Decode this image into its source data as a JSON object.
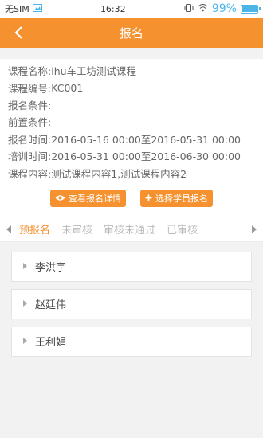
{
  "status_bar": {
    "carrier": "无SIM",
    "time": "16:32",
    "battery_percent": "99%",
    "battery_level": 0.99,
    "icons": [
      "gallery-icon",
      "vibrate-icon",
      "wifi-icon",
      "battery-icon"
    ]
  },
  "header": {
    "title": "报名",
    "back_icon": "back-arrow-icon",
    "color": "#f5912f"
  },
  "course": {
    "fields": [
      {
        "label": "课程名称:",
        "value": "lhu车工坊测试课程"
      },
      {
        "label": "课程编号:",
        "value": "KC001"
      },
      {
        "label": "报名条件:",
        "value": ""
      },
      {
        "label": "前置条件:",
        "value": ""
      },
      {
        "label": "报名时间:",
        "value": "2016-05-16 00:00至2016-05-31 00:00"
      },
      {
        "label": "培训时间:",
        "value": "2016-05-31 00:00至2016-06-30 00:00"
      },
      {
        "label": "课程内容:",
        "value": "测试课程内容1,测试课程内容2"
      }
    ]
  },
  "actions": {
    "view_details": "查看报名详情",
    "select_students": "选择学员报名"
  },
  "tabs": {
    "items": [
      "预报名",
      "未审核",
      "审核未通过",
      "已审核"
    ],
    "active_index": 0
  },
  "students": [
    {
      "name": "李洪宇"
    },
    {
      "name": "赵廷伟"
    },
    {
      "name": "王利娟"
    }
  ]
}
